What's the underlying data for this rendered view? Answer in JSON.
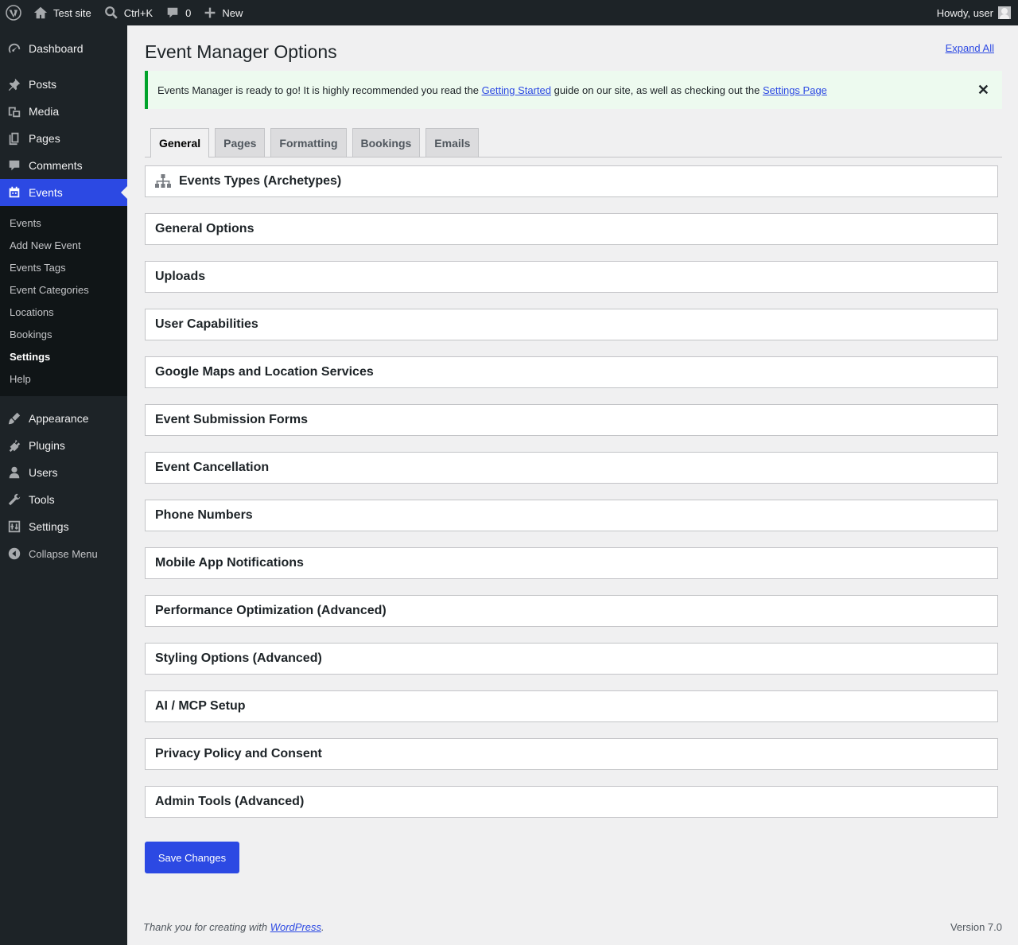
{
  "admin_bar": {
    "site_name": "Test site",
    "search_shortcut": "Ctrl+K",
    "comments_count": "0",
    "new_label": "New",
    "greeting": "Howdy, user"
  },
  "sidebar": {
    "items_top": [
      {
        "label": "Dashboard",
        "icon": "dashboard-icon"
      },
      {
        "label": "Posts",
        "icon": "pushpin-icon"
      },
      {
        "label": "Media",
        "icon": "media-icon"
      },
      {
        "label": "Pages",
        "icon": "pages-icon"
      },
      {
        "label": "Comments",
        "icon": "comment-icon"
      },
      {
        "label": "Events",
        "icon": "calendar-icon"
      }
    ],
    "events_submenu": [
      "Events",
      "Add New Event",
      "Events Tags",
      "Event Categories",
      "Locations",
      "Bookings",
      "Settings",
      "Help"
    ],
    "items_bottom": [
      {
        "label": "Appearance",
        "icon": "brush-icon"
      },
      {
        "label": "Plugins",
        "icon": "plugin-icon"
      },
      {
        "label": "Users",
        "icon": "user-icon"
      },
      {
        "label": "Tools",
        "icon": "wrench-icon"
      },
      {
        "label": "Settings",
        "icon": "settings-icon"
      }
    ],
    "collapse_label": "Collapse Menu"
  },
  "page": {
    "title": "Event Manager Options",
    "expand_all": "Expand All"
  },
  "notice": {
    "text_1": "Events Manager is ready to go! It is highly recommended you read the ",
    "link_1": "Getting Started",
    "text_2": " guide on our site, as well as checking out the ",
    "link_2": "Settings Page",
    "dismiss": "✕"
  },
  "tabs": [
    "General",
    "Pages",
    "Formatting",
    "Bookings",
    "Emails"
  ],
  "active_tab": "General",
  "sections": [
    "Events Types (Archetypes)",
    "General Options",
    "Uploads",
    "User Capabilities",
    "Google Maps and Location Services",
    "Event Submission Forms",
    "Event Cancellation",
    "Phone Numbers",
    "Mobile App Notifications",
    "Performance Optimization (Advanced)",
    "Styling Options (Advanced)",
    "AI / MCP Setup",
    "Privacy Policy and Consent",
    "Admin Tools (Advanced)"
  ],
  "save_button": "Save Changes",
  "footer": {
    "thanks_prefix": "Thank you for creating with ",
    "thanks_link": "WordPress",
    "thanks_suffix": ".",
    "version": "Version 7.0"
  }
}
